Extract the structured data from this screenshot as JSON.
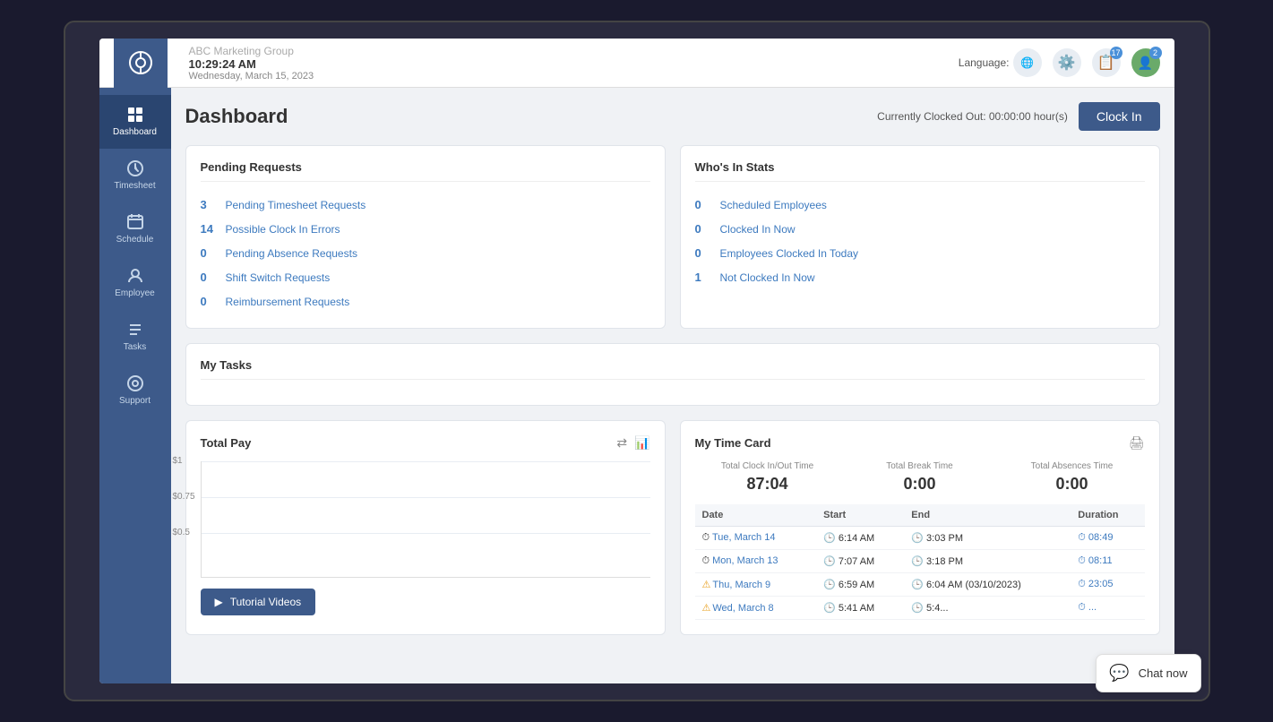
{
  "topbar": {
    "company": "ABC Marketing Group",
    "time": "10:29:24 AM",
    "date": "Wednesday, March 15, 2023",
    "language_label": "Language:",
    "notification_badge": "17",
    "avatar_badge": "2"
  },
  "sidebar": {
    "items": [
      {
        "id": "dashboard",
        "label": "Dashboard",
        "active": true
      },
      {
        "id": "timesheet",
        "label": "Timesheet",
        "active": false
      },
      {
        "id": "schedule",
        "label": "Schedule",
        "active": false
      },
      {
        "id": "employee",
        "label": "Employee",
        "active": false
      },
      {
        "id": "tasks",
        "label": "Tasks",
        "active": false
      },
      {
        "id": "support",
        "label": "Support",
        "active": false
      }
    ]
  },
  "dashboard": {
    "title": "Dashboard",
    "clock_status": "Currently Clocked Out: 00:00:00 hour(s)",
    "clock_in_btn": "Clock In"
  },
  "pending_requests": {
    "title": "Pending Requests",
    "items": [
      {
        "count": "3",
        "label": "Pending Timesheet Requests"
      },
      {
        "count": "14",
        "label": "Possible Clock In Errors"
      },
      {
        "count": "0",
        "label": "Pending Absence Requests"
      },
      {
        "count": "0",
        "label": "Shift Switch Requests"
      },
      {
        "count": "0",
        "label": "Reimbursement Requests"
      }
    ]
  },
  "whos_in_stats": {
    "title": "Who's In Stats",
    "items": [
      {
        "count": "0",
        "label": "Scheduled Employees"
      },
      {
        "count": "0",
        "label": "Clocked In Now"
      },
      {
        "count": "0",
        "label": "Employees Clocked In Today"
      },
      {
        "count": "1",
        "label": "Not Clocked In Now"
      }
    ]
  },
  "my_tasks": {
    "title": "My Tasks"
  },
  "total_pay": {
    "title": "Total Pay",
    "chart_labels": [
      "$1",
      "$0.75",
      "$0.5"
    ]
  },
  "my_time_card": {
    "title": "My Time Card",
    "stats": [
      {
        "label": "Total Clock In/Out Time",
        "value": "87:04"
      },
      {
        "label": "Total Break Time",
        "value": "0:00"
      },
      {
        "label": "Total Absences Time",
        "value": "0:00"
      }
    ],
    "table_headers": [
      "Date",
      "Start",
      "End",
      "Duration"
    ],
    "rows": [
      {
        "date": "Tue, March 14",
        "start": "6:14 AM",
        "end": "3:03 PM",
        "duration": "08:49",
        "warn": false
      },
      {
        "date": "Mon, March 13",
        "start": "7:07 AM",
        "end": "3:18 PM",
        "duration": "08:11",
        "warn": false
      },
      {
        "date": "Thu, March 9",
        "start": "6:59 AM",
        "end": "6:04 AM (03/10/2023)",
        "duration": "23:05",
        "warn": true
      },
      {
        "date": "Wed, March 8",
        "start": "5:41 AM",
        "end": "5:4...",
        "duration": "...",
        "warn": true
      }
    ]
  },
  "tutorial": {
    "btn_label": "Tutorial Videos"
  },
  "chat": {
    "label": "Chat now"
  }
}
